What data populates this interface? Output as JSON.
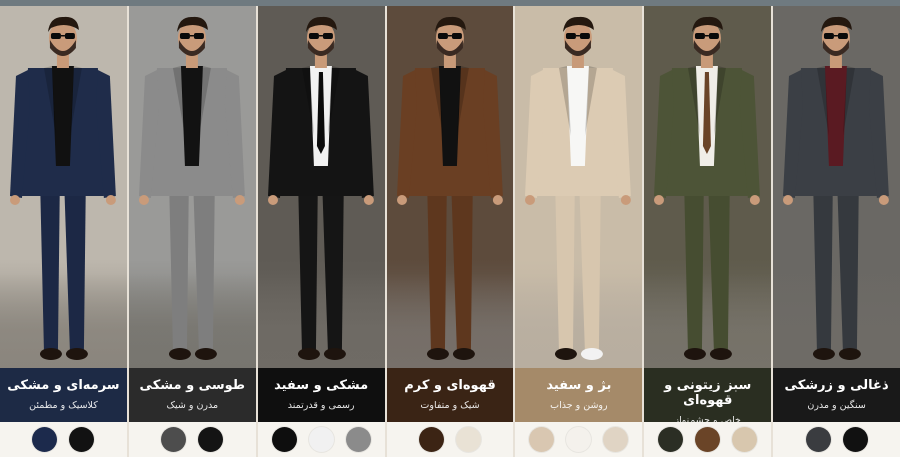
{
  "panels": [
    {
      "title": "سرمه‌ای و مشکی",
      "subtitle": "کلاسیک و مطمئن",
      "caption_bg": "#1d2a45",
      "suit": "#1f2c4a",
      "pants": "#1c2845",
      "shirt": "#111111",
      "tie": "",
      "wall": "#bdb7ad",
      "floor": "#8a857d",
      "swatches": [
        "#1c2a4c",
        "#121212"
      ]
    },
    {
      "title": "طوسی و مشکی",
      "subtitle": "مدرن و شیک",
      "caption_bg": "#2b2b2b",
      "suit": "#8b8b8b",
      "pants": "#7e7e7e",
      "shirt": "#121212",
      "tie": "",
      "wall": "#9a9a98",
      "floor": "#77756f",
      "swatches": [
        "#4d4d4d",
        "#141414"
      ]
    },
    {
      "title": "مشکی و سفید",
      "subtitle": "رسمی و قدرتمند",
      "caption_bg": "#0f0f0f",
      "suit": "#141414",
      "pants": "#151515",
      "shirt": "#f1f1f1",
      "tie": "#0b0b0b",
      "wall": "#5f5b55",
      "floor": "#6f6b65",
      "swatches": [
        "#0e0e0e",
        "#f1f1f1",
        "#8b8b8b"
      ]
    },
    {
      "title": "قهوه‌ای و کرم",
      "subtitle": "شیک و متفاوت",
      "caption_bg": "#3a2415",
      "suit": "#6a3f23",
      "pants": "#5e371e",
      "shirt": "#111111",
      "tie": "",
      "wall": "#5d4b3c",
      "floor": "#77706a",
      "swatches": [
        "#3c2414",
        "#e9e2d5"
      ]
    },
    {
      "title": "بژ و سفید",
      "subtitle": "روشن و جذاب",
      "caption_bg": "#a58a69",
      "suit": "#dccbb3",
      "pants": "#d7c6ae",
      "shirt": "#f7f7f5",
      "tie": "",
      "wall": "#c9bca8",
      "floor": "#b8aea0",
      "swatches": [
        "#d9c7b1",
        "#f4f1ec",
        "#e0d4c4"
      ]
    },
    {
      "title": "سبز زیتونی و قهوه‌ای",
      "subtitle": "خاص و چشم‌نواز",
      "caption_bg": "#2a2e21",
      "suit": "#4d5437",
      "pants": "#464d31",
      "shirt": "#f0eee8",
      "tie": "#6a4427",
      "wall": "#5f5b4c",
      "floor": "#77736a",
      "swatches": [
        "#2b2e24",
        "#6a4427",
        "#d8c7ae"
      ]
    },
    {
      "title": "ذغالی و زرشکی",
      "subtitle": "سنگین و مدرن",
      "caption_bg": "#191919",
      "suit": "#3b3f45",
      "pants": "#35393e",
      "shirt": "#5a1a22",
      "tie": "",
      "wall": "#6a6864",
      "floor": "#6e6b66",
      "swatches": [
        "#3a3c40",
        "#111111"
      ]
    }
  ]
}
